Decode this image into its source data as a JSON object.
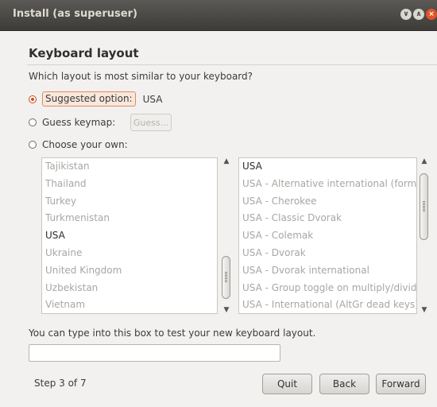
{
  "window": {
    "title": "Install (as superuser)",
    "controls": {
      "minimize": "∨",
      "maximize": "∧",
      "close": "×"
    }
  },
  "page": {
    "heading": "Keyboard layout",
    "question": "Which layout is most similar to your keyboard?"
  },
  "options": {
    "suggested_label": "Suggested option:",
    "suggested_value": "USA",
    "guess_label": "Guess keymap:",
    "guess_button": "Guess...",
    "choose_label": "Choose your own:"
  },
  "countries": [
    {
      "label": "Tajikistan",
      "selected": false
    },
    {
      "label": "Thailand",
      "selected": false
    },
    {
      "label": "Turkey",
      "selected": false
    },
    {
      "label": "Turkmenistan",
      "selected": false
    },
    {
      "label": "USA",
      "selected": true
    },
    {
      "label": "Ukraine",
      "selected": false
    },
    {
      "label": "United Kingdom",
      "selected": false
    },
    {
      "label": "Uzbekistan",
      "selected": false
    },
    {
      "label": "Vietnam",
      "selected": false
    }
  ],
  "variants": [
    {
      "label": "USA",
      "selected": true
    },
    {
      "label": "USA - Alternative international (former u",
      "selected": false
    },
    {
      "label": "USA - Cherokee",
      "selected": false
    },
    {
      "label": "USA - Classic Dvorak",
      "selected": false
    },
    {
      "label": "USA - Colemak",
      "selected": false
    },
    {
      "label": "USA - Dvorak",
      "selected": false
    },
    {
      "label": "USA - Dvorak international",
      "selected": false
    },
    {
      "label": "USA - Group toggle on multiply/divide ke",
      "selected": false
    },
    {
      "label": "USA - International (AltGr dead keys)",
      "selected": false
    }
  ],
  "test": {
    "label": "You can type into this box to test your new keyboard layout.",
    "value": ""
  },
  "footer": {
    "step": "Step 3 of 7",
    "quit": "Quit",
    "back": "Back",
    "forward": "Forward"
  },
  "colors": {
    "titlebar": "#3d3c38",
    "accent": "#d24e1c",
    "background": "#f2f1f0"
  }
}
